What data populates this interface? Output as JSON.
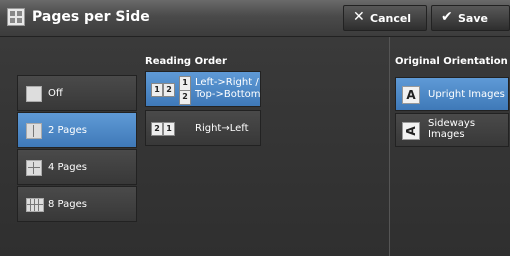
{
  "header": {
    "title": "Pages per Side",
    "cancel_label": "Cancel",
    "save_label": "Save"
  },
  "pages_section": {
    "options": [
      {
        "label": "Off",
        "selected": false
      },
      {
        "label": "2 Pages",
        "selected": true
      },
      {
        "label": "4 Pages",
        "selected": false
      },
      {
        "label": "8 Pages",
        "selected": false
      }
    ]
  },
  "reading_order": {
    "label": "Reading Order",
    "options": [
      {
        "label": "Left->Right /\nTop->Bottom",
        "selected": true
      },
      {
        "label": "Right→Left",
        "selected": false
      }
    ]
  },
  "original_orientation": {
    "label": "Original Orientation",
    "options": [
      {
        "label": "Upright Images",
        "selected": true
      },
      {
        "label": "Sideways\nImages",
        "selected": false
      }
    ]
  },
  "colors": {
    "accent": "#4a86c6",
    "background": "#333333"
  }
}
